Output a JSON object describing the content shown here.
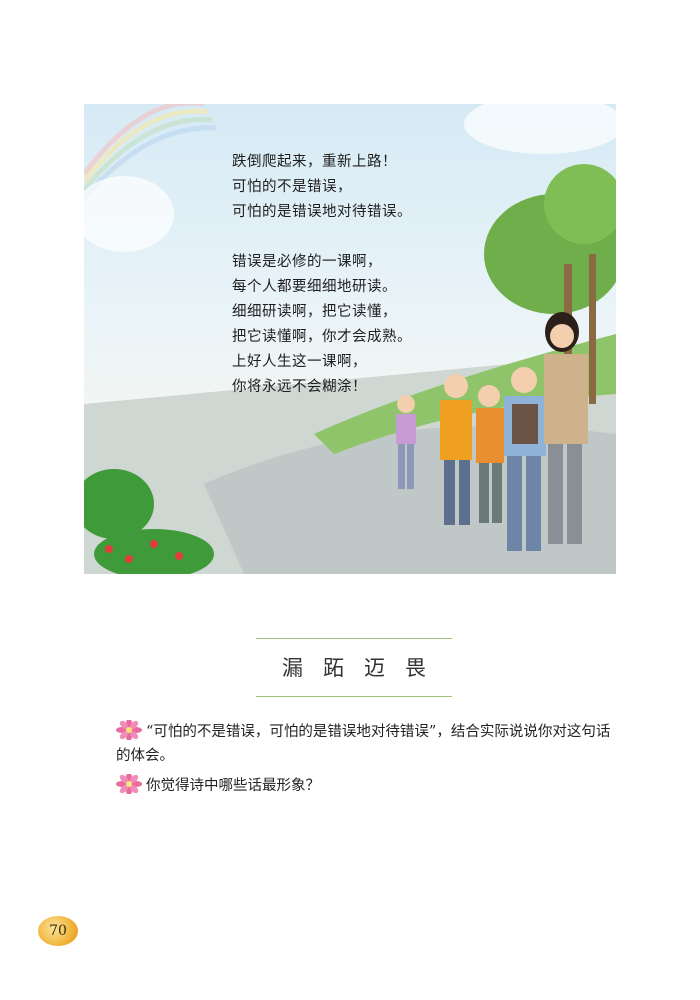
{
  "poem": {
    "stanza1": [
      "跌倒爬起来，重新上路！",
      "可怕的不是错误，",
      "可怕的是错误地对待错误。"
    ],
    "stanza2": [
      "错误是必修的一课啊，",
      "每个人都要细细地研读。",
      "细细研读啊，把它读懂，",
      "把它读懂啊，你才会成熟。",
      "上好人生这一课啊，",
      "你将永远不会糊涂！"
    ]
  },
  "section": {
    "title": "漏跖迈畏"
  },
  "questions": [
    {
      "icon": "flower-icon",
      "text": "“可怕的不是错误，可怕的是错误地对待错误”，结合实际说说你对这句话的体会。"
    },
    {
      "icon": "flower-icon",
      "text": "你觉得诗中哪些话最形象？"
    }
  ],
  "page": {
    "number": "70"
  },
  "colors": {
    "rule": "#9cc47a",
    "flower": "#e86aa0",
    "page_badge": "#f1b43a"
  }
}
